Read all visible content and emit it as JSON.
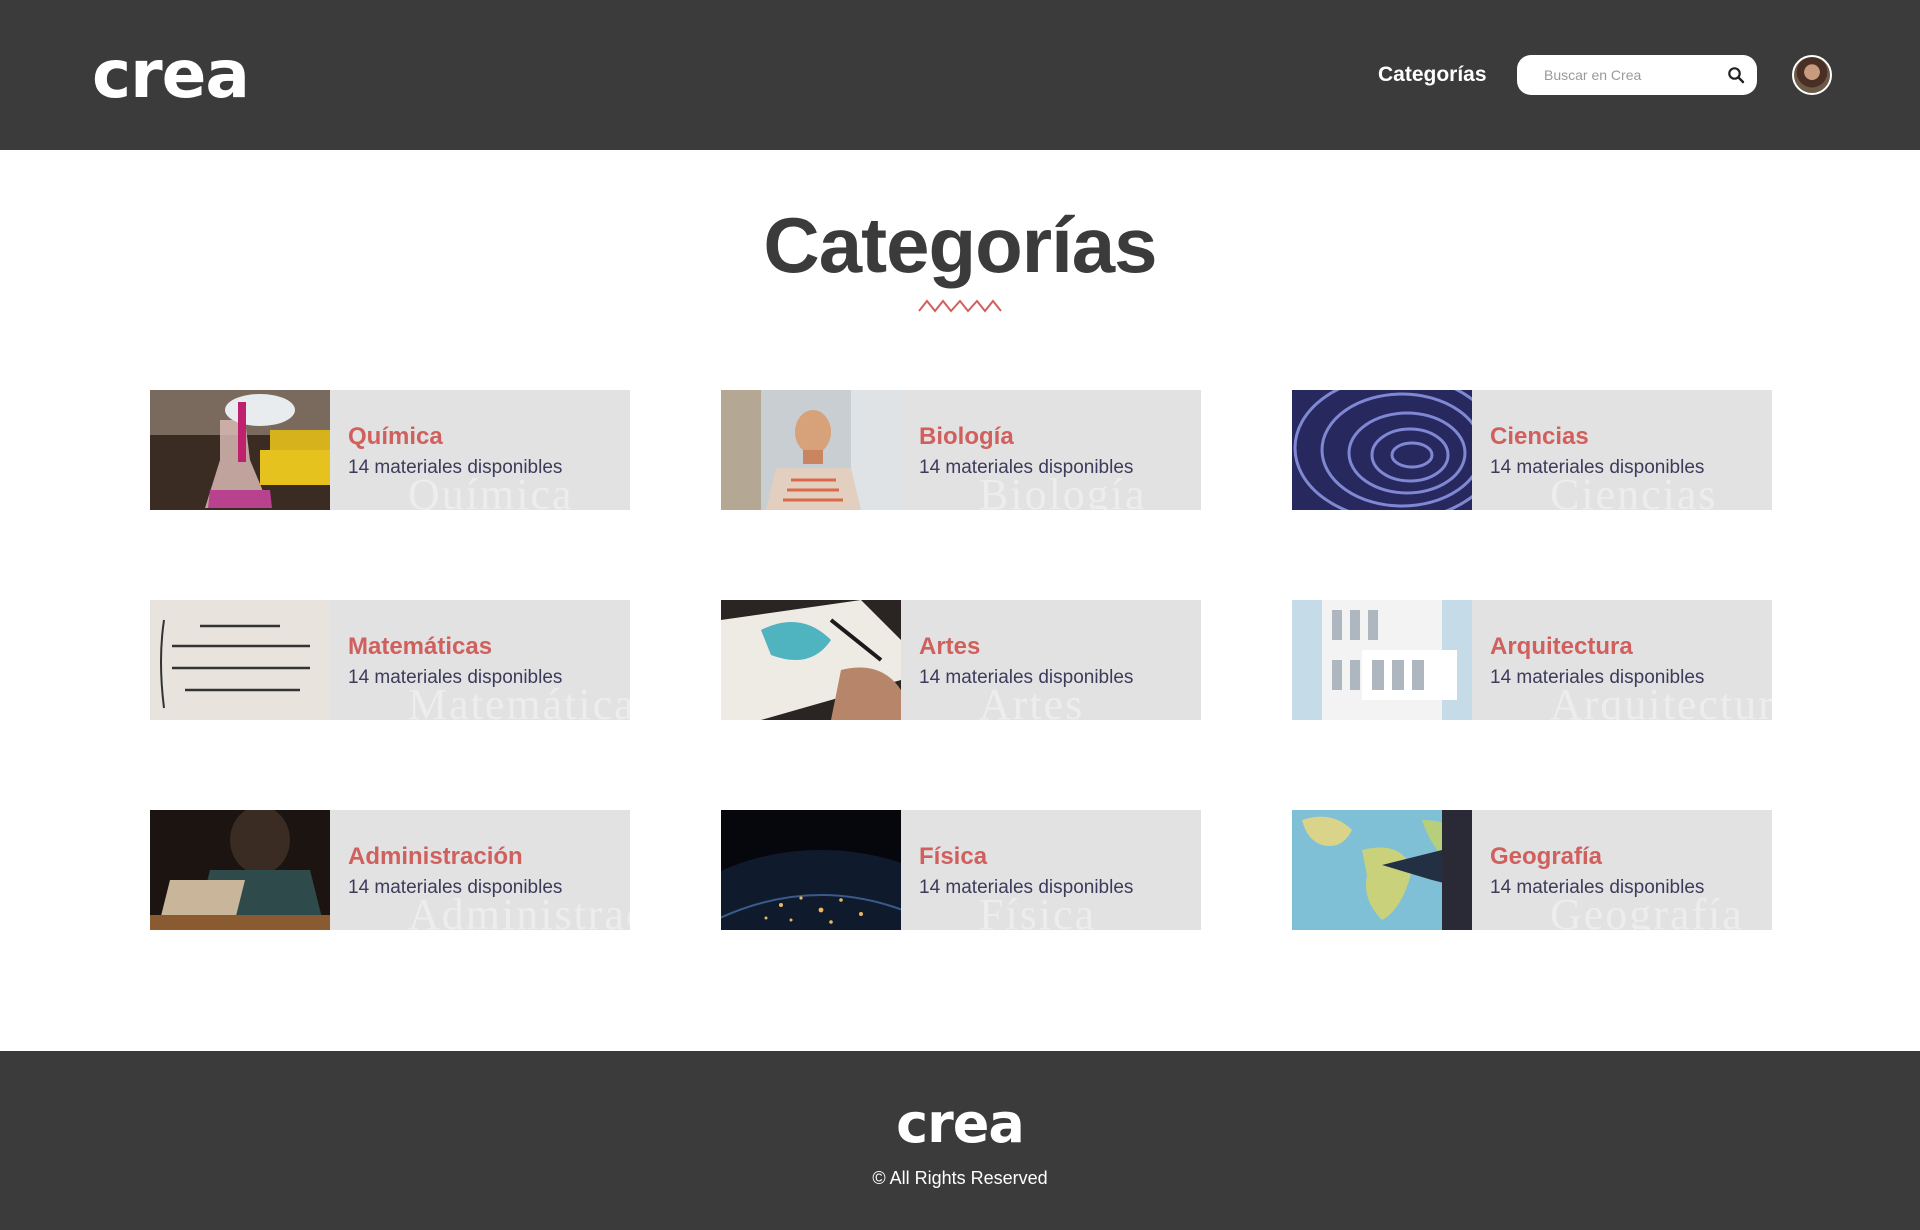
{
  "header": {
    "logo": "crea",
    "nav_categories": "Categorías",
    "search": {
      "placeholder": "Buscar en Crea"
    }
  },
  "main": {
    "title": "Categorías",
    "accent_color": "#d0605e",
    "categories": [
      {
        "name": "Química",
        "materials": "14 materiales disponibles",
        "watermark": "Química",
        "image": "chemistry-lab-photo"
      },
      {
        "name": "Biología",
        "materials": "14 materiales disponibles",
        "watermark": "Biología",
        "image": "anatomy-model-photo"
      },
      {
        "name": "Ciencias",
        "materials": "14 materiales disponibles",
        "watermark": "Ciencias",
        "image": "blue-spiral-photo"
      },
      {
        "name": "Matemáticas",
        "materials": "14 materiales disponibles",
        "watermark": "Matemáticas",
        "image": "equations-photo"
      },
      {
        "name": "Artes",
        "materials": "14 materiales disponibles",
        "watermark": "Artes",
        "image": "watercolor-painting-photo"
      },
      {
        "name": "Arquitectura",
        "materials": "14 materiales disponibles",
        "watermark": "Arquitectura",
        "image": "white-building-photo"
      },
      {
        "name": "Administración",
        "materials": "14 materiales disponibles",
        "watermark": "Administración",
        "image": "laptop-office-photo"
      },
      {
        "name": "Física",
        "materials": "14 materiales disponibles",
        "watermark": "Física",
        "image": "earth-at-night-photo"
      },
      {
        "name": "Geografía",
        "materials": "14 materiales disponibles",
        "watermark": "Geografía",
        "image": "world-map-photo"
      }
    ]
  },
  "footer": {
    "logo": "crea",
    "copyright": "© All Rights Reserved"
  }
}
